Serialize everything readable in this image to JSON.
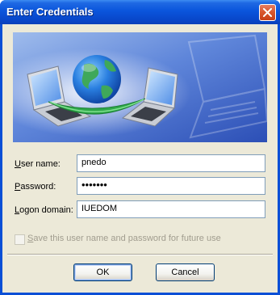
{
  "window": {
    "title": "Enter Credentials"
  },
  "form": {
    "username_label_key": "U",
    "username_label_rest": "ser name:",
    "username_value": "pnedo",
    "password_label_key": "P",
    "password_label_rest": "assword:",
    "password_value": "•••••••",
    "domain_label_key": "L",
    "domain_label_rest": "ogon domain:",
    "domain_value": "IUEDOM"
  },
  "save": {
    "label_key": "S",
    "label_rest": "ave this user name and password for future use",
    "checked": false,
    "enabled": false
  },
  "buttons": {
    "ok": "OK",
    "cancel": "Cancel"
  },
  "colors": {
    "titlebar": "#0a55dc",
    "dialog_bg": "#ece9d8",
    "field_border": "#7f9db9",
    "disabled_text": "#a19d8f"
  },
  "icons": {
    "close": "close-icon",
    "banner": "network-globe-laptops-illustration"
  }
}
